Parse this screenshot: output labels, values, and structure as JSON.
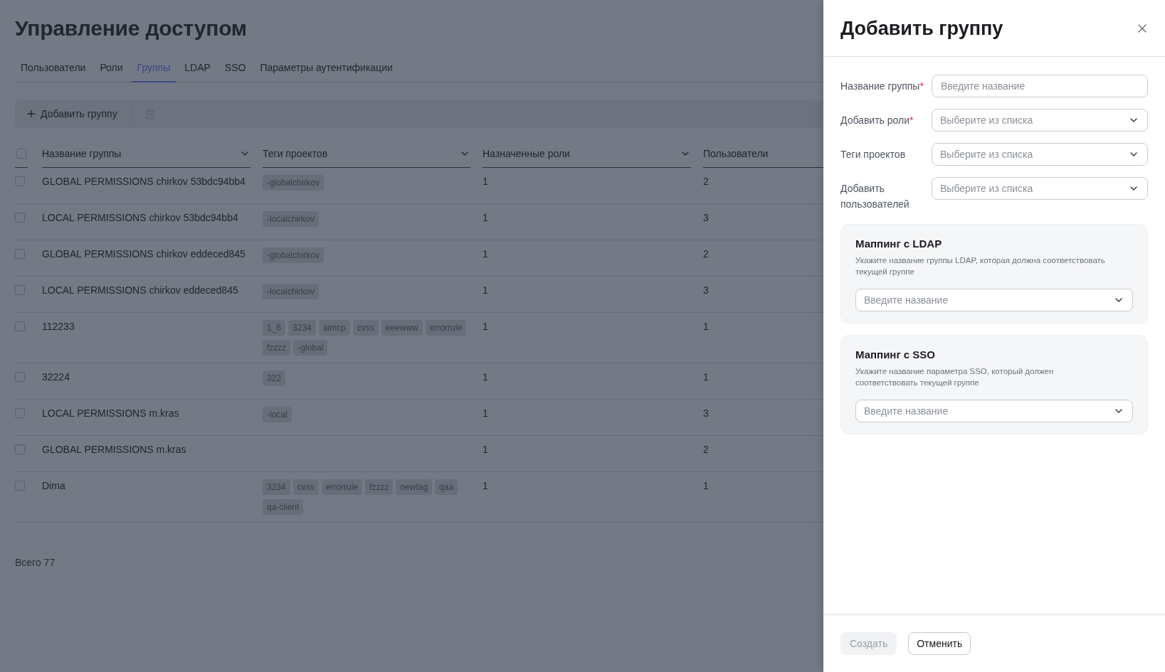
{
  "page": {
    "title": "Управление доступом"
  },
  "tabs": [
    {
      "label": "Пользователи",
      "selected": false
    },
    {
      "label": "Роли",
      "selected": false
    },
    {
      "label": "Группы",
      "selected": true
    },
    {
      "label": "LDAP",
      "selected": false
    },
    {
      "label": "SSO",
      "selected": false
    },
    {
      "label": "Параметры аутентификации",
      "selected": false
    }
  ],
  "toolbar": {
    "add_button": "Добавить группу",
    "delete_disabled": true
  },
  "table": {
    "all_checked": false,
    "columns": [
      {
        "label": "Название группы",
        "menu": true
      },
      {
        "label": "Теги проектов",
        "menu": true
      },
      {
        "label": "Назначенные роли",
        "menu": true
      },
      {
        "label": "Пользователи",
        "menu": false
      }
    ],
    "rows": [
      {
        "checked": false,
        "name": "GLOBAL PERMISSIONS chirkov 53bdc94bb4",
        "tags": [
          "-globalchirkov"
        ],
        "roles": "1",
        "users": "2"
      },
      {
        "checked": false,
        "name": "LOCAL PERMISSIONS chirkov 53bdc94bb4",
        "tags": [
          "-localchirkov"
        ],
        "roles": "1",
        "users": "3"
      },
      {
        "checked": false,
        "name": "GLOBAL PERMISSIONS chirkov eddeced845",
        "tags": [
          "-globalchirkov"
        ],
        "roles": "1",
        "users": "2"
      },
      {
        "checked": false,
        "name": "LOCAL PERMISSIONS chirkov eddeced845",
        "tags": [
          "-localchirkov"
        ],
        "roles": "1",
        "users": "3"
      },
      {
        "checked": false,
        "name": "112233",
        "tags": [
          "1_6",
          "3234",
          "aimcp",
          "cvss",
          "eeewww",
          "errorrule",
          "fzzzz",
          "-global"
        ],
        "roles": "1",
        "users": "1"
      },
      {
        "checked": false,
        "name": "32224",
        "tags": [
          "322"
        ],
        "roles": "1",
        "users": "1"
      },
      {
        "checked": false,
        "name": "LOCAL PERMISSIONS m.kras",
        "tags": [
          "-local"
        ],
        "roles": "1",
        "users": "3"
      },
      {
        "checked": false,
        "name": "GLOBAL PERMISSIONS m.kras",
        "roles": "1",
        "users": "2"
      },
      {
        "checked": false,
        "name": "Dima",
        "tags": [
          "3234",
          "cvss",
          "errorrule",
          "fzzzz",
          "newtag",
          "qaa",
          "qa-client"
        ],
        "roles": "1",
        "users": "1"
      }
    ]
  },
  "footer": {
    "total": "Всего 77"
  },
  "drawer": {
    "title": "Добавить группу",
    "fields": [
      {
        "label": "Название группы",
        "required_mark": "*",
        "kind": "text",
        "placeholder": "Введите название"
      },
      {
        "label": "Добавить роли",
        "required_mark": "*",
        "kind": "select",
        "placeholder": "Выберите из списка"
      },
      {
        "label": "Теги проектов",
        "kind": "select",
        "placeholder": "Выберите из списка"
      },
      {
        "label": "Добавить пользователей",
        "kind": "select",
        "placeholder": "Выберите из списка"
      }
    ],
    "mappings": [
      {
        "title": "Маппинг с LDAP",
        "description": "Укажите название группы LDAP, которая должна соответствовать текущей группе",
        "kind": "select",
        "placeholder": "Введите название"
      },
      {
        "title": "Маппинг с SSO",
        "description": "Укажите название параметра SSO, который должен соответствовать текущей группе",
        "kind": "select",
        "placeholder": "Введите название"
      }
    ],
    "buttons": [
      {
        "label": "Создать",
        "kind": "primary",
        "disabled": true
      },
      {
        "label": "Отменить",
        "kind": "secondary",
        "disabled": false
      }
    ]
  }
}
